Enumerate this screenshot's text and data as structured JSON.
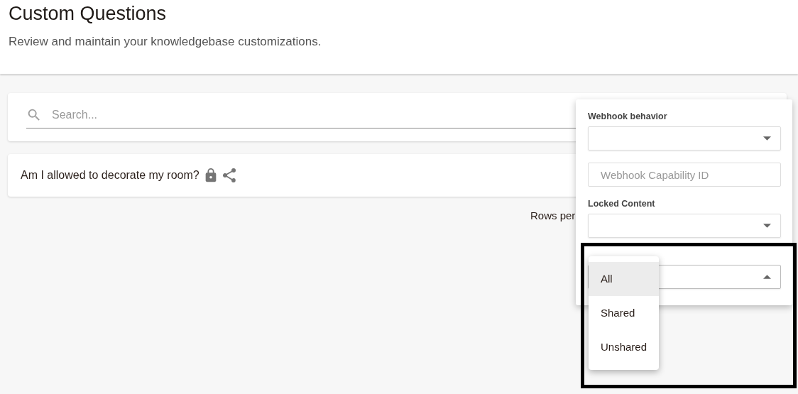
{
  "header": {
    "title": "Custom Questions",
    "subtitle": "Review and maintain your knowledgebase customizations."
  },
  "search": {
    "placeholder": "Search..."
  },
  "questions": [
    {
      "text": "Am I allowed to decorate my room?",
      "locked": true,
      "shared": true
    }
  ],
  "pagination": {
    "rows_per_page_label": "Rows per"
  },
  "filter_panel": {
    "fields": [
      {
        "kind": "select",
        "label": "Webhook behavior",
        "expanded": false
      },
      {
        "kind": "text",
        "placeholder": "Webhook Capability ID"
      },
      {
        "kind": "select",
        "label": "Locked Content",
        "expanded": false
      },
      {
        "kind": "select",
        "expanded": true,
        "options": [
          {
            "label": "All",
            "selected": true
          },
          {
            "label": "Shared",
            "selected": false
          },
          {
            "label": "Unshared",
            "selected": false
          }
        ]
      }
    ]
  }
}
